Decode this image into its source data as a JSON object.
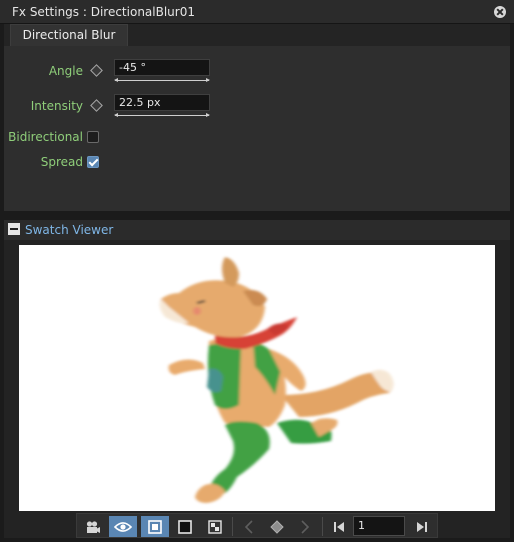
{
  "window": {
    "title": "Fx Settings : DirectionalBlur01"
  },
  "tabs": [
    {
      "label": "Directional Blur"
    }
  ],
  "params": {
    "angle": {
      "label": "Angle",
      "value": "-45 °"
    },
    "intensity": {
      "label": "Intensity",
      "value": "22.5 px"
    },
    "bidirectional": {
      "label": "Bidirectional",
      "checked": false
    },
    "spread": {
      "label": "Spread",
      "checked": true
    }
  },
  "swatch_viewer": {
    "title": "Swatch Viewer",
    "frame_value": "1"
  },
  "toolbar": {
    "buttons": [
      {
        "icon": "camera-icon",
        "active": false
      },
      {
        "icon": "eye-icon",
        "active": true
      },
      {
        "icon": "fill-square-icon",
        "active": true
      },
      {
        "icon": "outline-square-icon",
        "active": false
      },
      {
        "icon": "checkerboard-icon",
        "active": false
      },
      {
        "icon": "prev-key-icon",
        "active": false
      },
      {
        "icon": "keyframe-icon",
        "active": false
      },
      {
        "icon": "next-key-icon",
        "active": false
      },
      {
        "icon": "first-frame-icon",
        "active": false
      },
      {
        "icon": "last-frame-icon",
        "active": false
      }
    ]
  },
  "colors": {
    "accent": "#5a86b3",
    "label_green": "#8fce7a",
    "swatch_title_blue": "#7fb6e6"
  }
}
